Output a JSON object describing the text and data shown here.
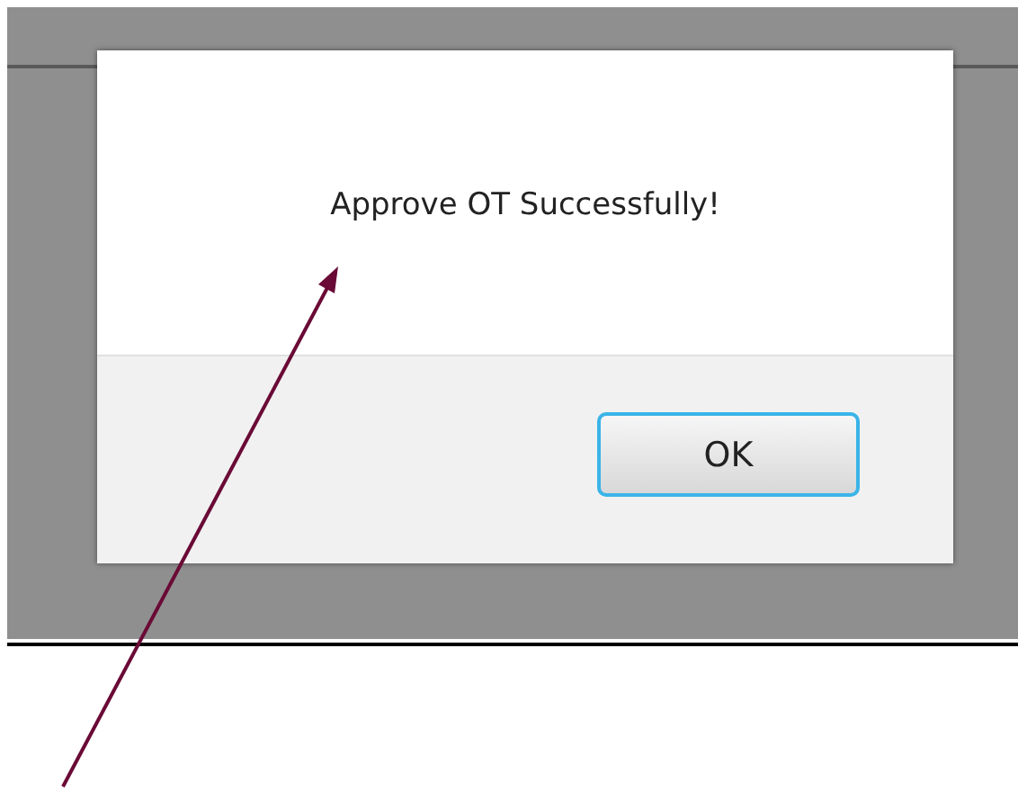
{
  "dialog": {
    "message": "Approve OT Successfully!",
    "buttons": [
      {
        "label": "OK",
        "focused": true
      }
    ]
  },
  "annotation": {
    "kind": "arrow"
  }
}
